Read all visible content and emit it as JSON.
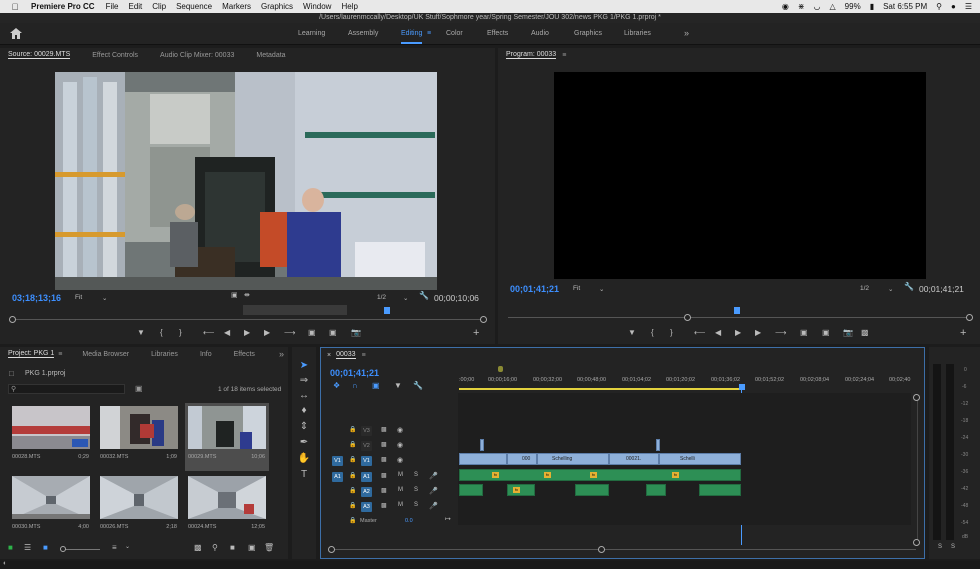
{
  "menubar": {
    "app_name": "Premiere Pro CC",
    "items": [
      "File",
      "Edit",
      "Clip",
      "Sequence",
      "Markers",
      "Graphics",
      "Window",
      "Help"
    ],
    "battery": "99%",
    "clock": "Sat 6:55 PM"
  },
  "window_title": "/Users/laurenmccally/Desktop/UK Stuff/Sophmore year/Spring Semester/JOU 302/news PKG 1/PKG 1.prproj *",
  "workspaces": [
    "Learning",
    "Assembly",
    "Editing",
    "Color",
    "Effects",
    "Audio",
    "Graphics",
    "Libraries"
  ],
  "active_workspace": "Editing",
  "source": {
    "tabs": [
      "Source: 00029.MTS",
      "Effect Controls",
      "Audio Clip Mixer: 00033",
      "Metadata"
    ],
    "timecode": "03;18;13;16",
    "fit": "Fit",
    "resolution": "1/2",
    "duration": "00;00;10;06"
  },
  "program": {
    "title": "Program: 00033",
    "timecode": "00;01;41;21",
    "fit": "Fit",
    "resolution": "1/2",
    "duration": "00;01;41;21"
  },
  "project": {
    "tabs": [
      "Project: PKG 1",
      "Media Browser",
      "Libraries",
      "Info",
      "Effects"
    ],
    "file": "PKG 1.prproj",
    "search_placeholder": "",
    "selection": "1 of 18 items selected",
    "clips": [
      {
        "name": "00028.MTS",
        "dur": "0;29"
      },
      {
        "name": "00032.MTS",
        "dur": "1;09"
      },
      {
        "name": "00029.MTS",
        "dur": "10;06"
      },
      {
        "name": "00030.MTS",
        "dur": "4;00"
      },
      {
        "name": "00026.MTS",
        "dur": "2;18"
      },
      {
        "name": "00024.MTS",
        "dur": "12;05"
      }
    ]
  },
  "timeline": {
    "tab": "00033",
    "timecode": "00;01;41;21",
    "ruler": [
      ":00;00",
      "00;00;16;00",
      "00;00;32;00",
      "00;00;48;00",
      "00;01;04;02",
      "00;01;20;02",
      "00;01;36;02",
      "00;01;52;02",
      "00;02;08;04",
      "00;02;24;04",
      "00;02;40"
    ],
    "video_tracks": [
      "V3",
      "V2",
      "V1"
    ],
    "audio_tracks": [
      "A1",
      "A2",
      "A3"
    ],
    "master_label": "Master",
    "master_value": "0.0",
    "source_v1": "V1",
    "source_a1": "A1",
    "clip_labels": [
      "000",
      "Schelling",
      "00021.",
      "Schelli"
    ]
  },
  "meters": {
    "scale": [
      "0",
      "-6",
      "-12",
      "-18",
      "-24",
      "-30",
      "-36",
      "-42",
      "-48",
      "-54",
      "dB"
    ],
    "solo": [
      "S",
      "S"
    ]
  }
}
